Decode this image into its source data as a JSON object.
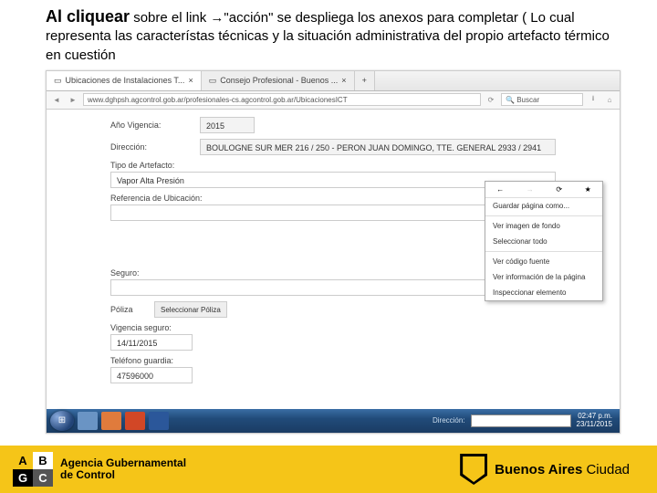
{
  "slide": {
    "title_bold": "Al cliquear",
    "title_rest": " sobre el link →\"acción\" se despliega los anexos para completar ( Lo cual representa las característas técnicas y la situación administrativa del propio artefacto térmico en cuestión"
  },
  "browser": {
    "tab1": "Ubicaciones de Instalaciones T...",
    "tab2": "Consejo Profesional - Buenos ...",
    "url": "www.dghpsh.agcontrol.gob.ar/profesionales-cs.agcontrol.gob.ar/UbicacionesICT",
    "search_ph": "Buscar"
  },
  "form": {
    "ano_label": "Año Vigencia:",
    "ano_value": "2015",
    "dir_label": "Dirección:",
    "dir_value": "BOULOGNE SUR MER 216 / 250 - PERON JUAN DOMINGO, TTE. GENERAL 2933 / 2941",
    "tipo_label": "Tipo de Artefacto:",
    "tipo_value": "Vapor Alta Presión",
    "ref_label": "Referencia de Ubicación:",
    "seguro_label": "Seguro:",
    "poliza_label": "Póliza",
    "poliza_btn": "Seleccionar Póliza",
    "vig_label": "Vigencia seguro:",
    "vig_value": "14/11/2015",
    "tel_label": "Teléfono guardia:",
    "tel_value": "47596000"
  },
  "ctx": {
    "save": "Guardar página como...",
    "bg": "Ver imagen de fondo",
    "sel": "Seleccionar todo",
    "src": "Ver código fuente",
    "info": "Ver información de la página",
    "insp": "Inspeccionar elemento"
  },
  "taskbar": {
    "addr_label": "Dirección:",
    "time": "02:47 p.m.",
    "date": "23/11/2015"
  },
  "footer": {
    "agc1": "Agencia Gubernamental",
    "agc2": "de Control",
    "ba": "Buenos Aires Ciudad",
    "A": "A",
    "G": "G",
    "B": "B",
    "C": "C"
  }
}
